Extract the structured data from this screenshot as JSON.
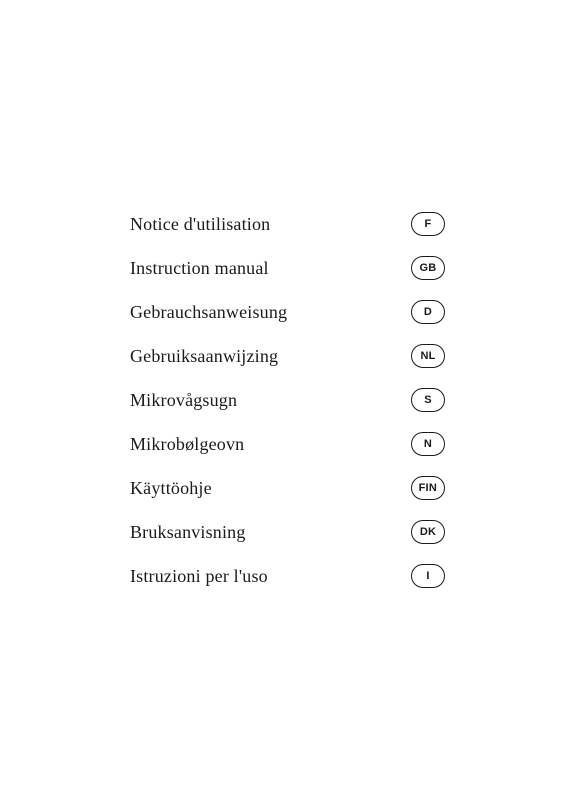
{
  "items": [
    {
      "id": "french",
      "label": "Notice d'utilisation",
      "badge": "F"
    },
    {
      "id": "english",
      "label": "Instruction manual",
      "badge": "GB"
    },
    {
      "id": "german",
      "label": "Gebrauchsanweisung",
      "badge": "D"
    },
    {
      "id": "dutch",
      "label": "Gebruiksaanwijzing",
      "badge": "NL"
    },
    {
      "id": "swedish",
      "label": "Mikrovågsugn",
      "badge": "S"
    },
    {
      "id": "norwegian",
      "label": "Mikrobølgeovn",
      "badge": "N"
    },
    {
      "id": "finnish",
      "label": "Käyttöohje",
      "badge": "FIN"
    },
    {
      "id": "danish",
      "label": "Bruksanvisning",
      "badge": "DK"
    },
    {
      "id": "italian",
      "label": "Istruzioni per l'uso",
      "badge": "I"
    }
  ]
}
